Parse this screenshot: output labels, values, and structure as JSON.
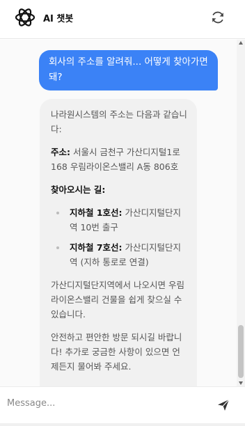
{
  "header": {
    "title": "AI 챗봇",
    "logo_icon": "openai-knot-icon",
    "refresh_icon": "refresh-icon"
  },
  "chat": {
    "user_message": "회사의 주소를 알려줘... 어떻게 찾아가면 돼?",
    "bot": {
      "intro": "나라원시스템의 주소는 다음과 같습니다:",
      "address_label": "주소:",
      "address_value": " 서울시 금천구 가산디지털1로 168 우림라이온스밸리 A동 806호",
      "directions_label": "찾아오시는 길:",
      "routes": [
        {
          "label": "지하철 1호선:",
          "text": " 가산디지털단지역 10번 출구"
        },
        {
          "label": "지하철 7호선:",
          "text": " 가산디지털단지역 (지하 통로로 연결)"
        }
      ],
      "para1": "가산디지털단지역에서 나오시면 우림라이온스밸리 건물을 쉽게 찾으실 수 있습니다.",
      "para2": "안전하고 편안한 방문 되시길 바랍니다! 추가로 궁금한 사항이 있으면 언제든지 물어봐 주세요."
    }
  },
  "input": {
    "placeholder": "Message...",
    "value": "",
    "send_icon": "send-icon"
  },
  "colors": {
    "user_bubble": "#3b82f6",
    "bot_bubble": "#f1f1f1",
    "accent": "#3b82f6"
  }
}
